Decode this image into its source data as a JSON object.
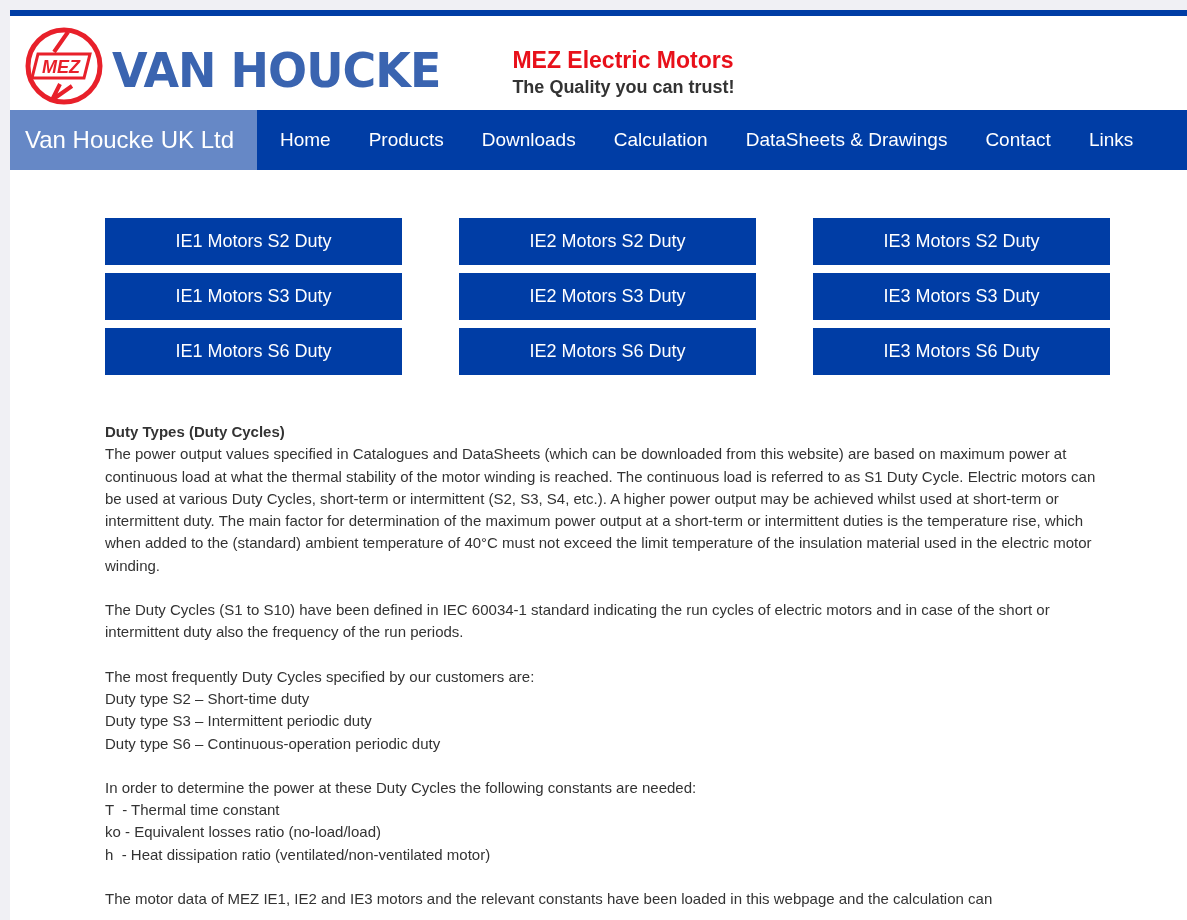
{
  "header": {
    "logo_emblem": "MEZ",
    "logo_wordmark": "VAN HOUCKE",
    "tagline_title": "MEZ Electric Motors",
    "tagline": "The Quality you can trust!"
  },
  "nav": {
    "brand": "Van Houcke UK Ltd",
    "items": [
      {
        "label": "Home",
        "selected": false
      },
      {
        "label": "Products",
        "selected": false
      },
      {
        "label": "Downloads",
        "selected": false
      },
      {
        "label": "Calculation",
        "selected": false
      },
      {
        "label": "DataSheets & Drawings",
        "selected": false
      },
      {
        "label": "Contact",
        "selected": false
      },
      {
        "label": "Links",
        "selected": false
      }
    ]
  },
  "motor_buttons": [
    [
      "IE1 Motors S2 Duty",
      "IE2 Motors S2 Duty",
      "IE3 Motors S2 Duty"
    ],
    [
      "IE1 Motors S3 Duty",
      "IE2 Motors S3 Duty",
      "IE3 Motors S3 Duty"
    ],
    [
      "IE1 Motors S6 Duty",
      "IE2 Motors S6 Duty",
      "IE3 Motors S6 Duty"
    ]
  ],
  "content": [
    [
      {
        "kind": "heading",
        "text": "Duty Types (Duty Cycles)"
      },
      {
        "kind": "paragraph",
        "text": "The power output values specified in Catalogues and DataSheets (which can be downloaded from this website) are based on maximum power at continuous load at what the thermal stability of the motor winding is reached. The continuous load is referred to as S1 Duty Cycle. Electric motors can be used at various Duty Cycles, short-term or intermittent (S2, S3, S4, etc.). A higher power output may be achieved whilst used at short-term or intermittent duty. The main factor for determination of the maximum power output at a short-term or intermittent duties is the temperature rise, which when added to the (standard) ambient temperature of 40°C must not exceed the limit temperature of the insulation material used in the electric motor winding."
      }
    ],
    [
      {
        "kind": "paragraph",
        "text": "The Duty Cycles (S1 to S10) have been defined in IEC 60034-1 standard indicating the run cycles of electric motors and in case of the short or intermittent duty also the frequency of the run periods."
      }
    ],
    [
      {
        "kind": "paragraph",
        "text": "The most frequently Duty Cycles specified by our customers are:"
      },
      {
        "kind": "paragraph",
        "text": "Duty type S2 – Short-time duty"
      },
      {
        "kind": "paragraph",
        "text": "Duty type S3 – Intermittent periodic duty"
      },
      {
        "kind": "paragraph",
        "text": "Duty type S6 – Continuous-operation periodic duty"
      }
    ],
    [
      {
        "kind": "paragraph",
        "text": "In order to determine the power at these Duty Cycles the following constants are needed:"
      },
      {
        "kind": "paragraph",
        "text": "T  - Thermal time constant"
      },
      {
        "kind": "paragraph",
        "text": "ko - Equivalent losses ratio (no-load/load)"
      },
      {
        "kind": "paragraph",
        "text": "h  - Heat dissipation ratio (ventilated/non-ventilated motor)"
      }
    ],
    [
      {
        "kind": "paragraph",
        "text": "The motor data of MEZ IE1, IE2 and IE3 motors and the relevant constants have been loaded in this webpage and the calculation can"
      }
    ]
  ]
}
